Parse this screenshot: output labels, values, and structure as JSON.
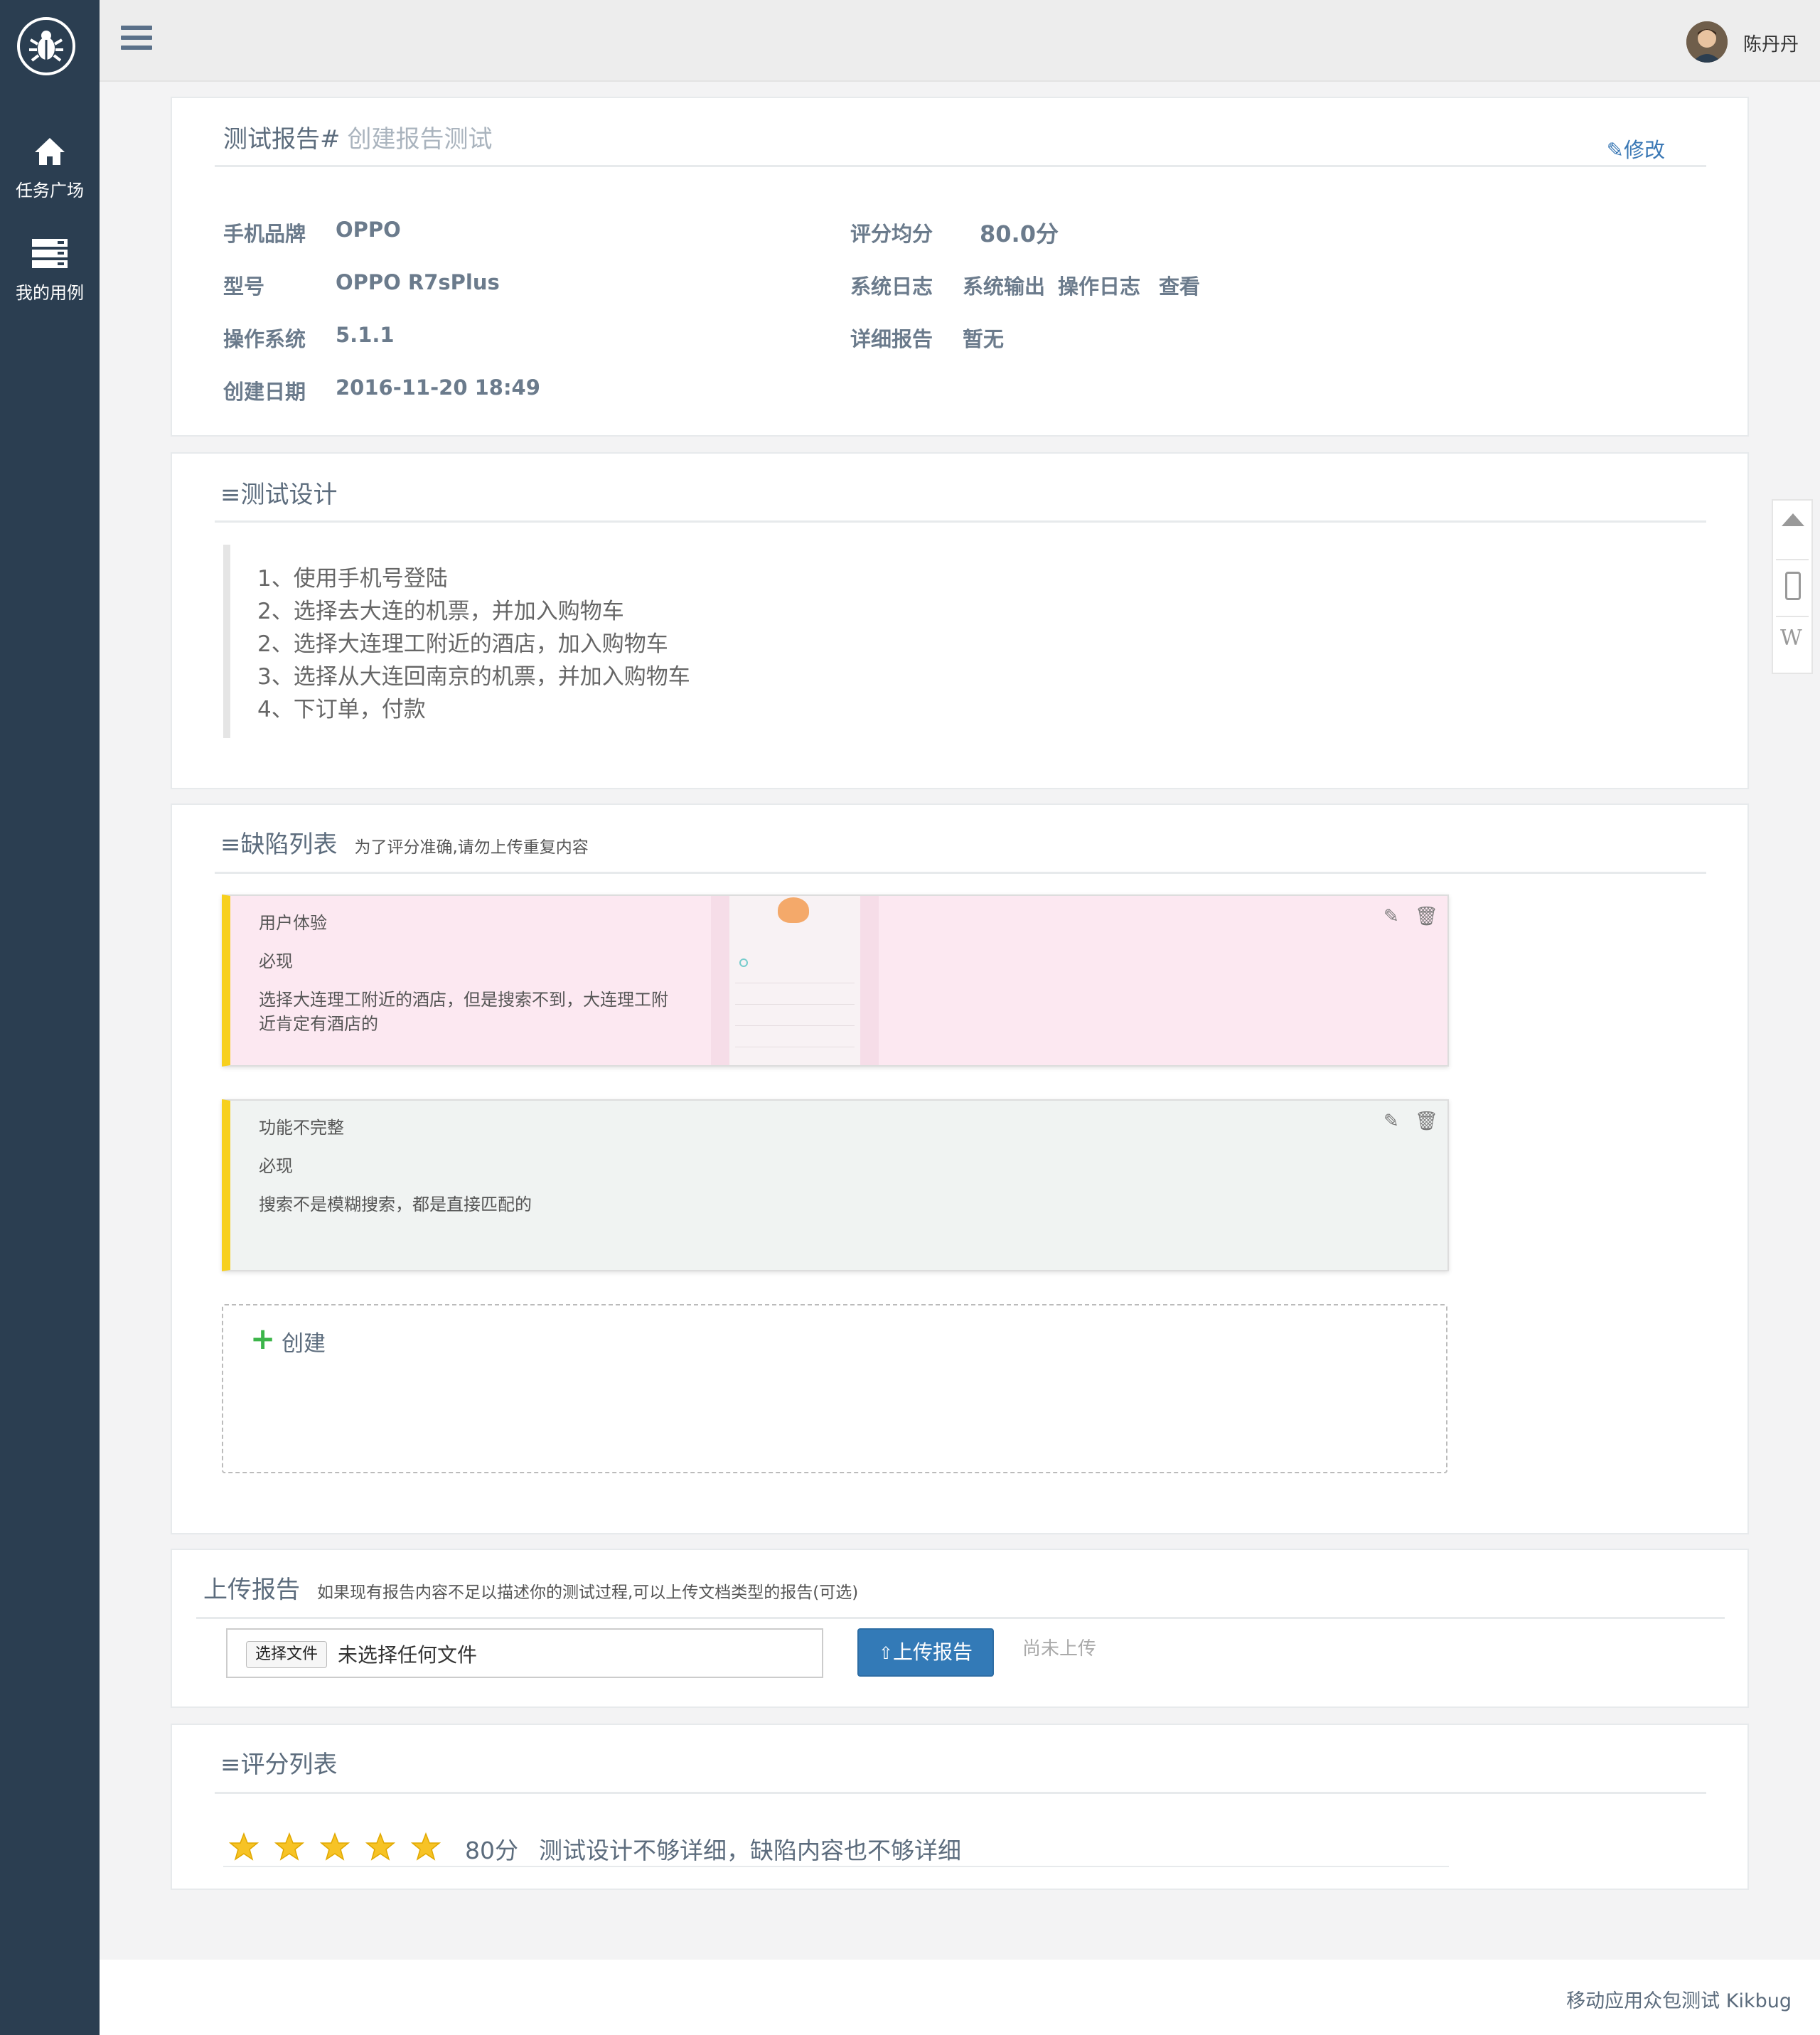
{
  "sidebar": {
    "items": [
      {
        "label": "任务广场",
        "icon": "home-icon"
      },
      {
        "label": "我的用例",
        "icon": "server-icon"
      }
    ]
  },
  "header": {
    "username": "陈丹丹"
  },
  "report": {
    "title_prefix": "测试报告#",
    "title_name": "创建报告测试",
    "edit_label": "修改",
    "fields": {
      "brand_label": "手机品牌",
      "brand": "OPPO",
      "model_label": "型号",
      "model": "OPPO R7sPlus",
      "os_label": "操作系统",
      "os": "5.1.1",
      "date_label": "创建日期",
      "date": "2016-11-20 18:49",
      "score_label": "评分均分",
      "score": "80.0分",
      "syslog_label": "系统日志",
      "syslog_output": "系统输出",
      "syslog_ops": "操作日志",
      "syslog_view": "查看",
      "detail_label": "详细报告",
      "detail": "暂无"
    }
  },
  "design": {
    "title": "≡测试设计",
    "steps": [
      "1、使用手机号登陆",
      "2、选择去大连的机票，并加入购物车",
      "2、选择大连理工附近的酒店，加入购物车",
      "3、选择从大连回南京的机票，并加入购物车",
      "4、下订单，付款"
    ]
  },
  "defects": {
    "title": "≡缺陷列表",
    "subtitle": "为了评分准确,请勿上传重复内容",
    "items": [
      {
        "category": "用户体验",
        "frequency": "必现",
        "desc1": "选择大连理工附近的酒店，但是搜索不到，大连理工附",
        "desc2": "近肯定有酒店的",
        "bg": "#fce8f1"
      },
      {
        "category": "功能不完整",
        "frequency": "必现",
        "desc1": "搜索不是模糊搜索，都是直接匹配的",
        "desc2": "",
        "bg": "#f0f3f2"
      }
    ],
    "create_label": "创建"
  },
  "upload": {
    "title": "上传报告",
    "subtitle": "如果现有报告内容不足以描述你的测试过程,可以上传文档类型的报告(可选)",
    "choose_label": "选择文件",
    "file_status": "未选择任何文件",
    "upload_label": "上传报告",
    "status": "尚未上传"
  },
  "ratings": {
    "title": "≡评分列表",
    "stars": 5,
    "score": "80分",
    "comment": "测试设计不够详细，缺陷内容也不够详细"
  },
  "footer": {
    "text": "移动应用众包测试 Kikbug"
  },
  "colors": {
    "sidebar": "#2b3e51",
    "accent": "#337ab7",
    "defect_bar": "#f7d01e",
    "plus": "#3cb54a"
  }
}
